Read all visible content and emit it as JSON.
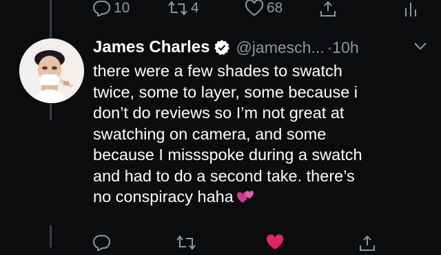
{
  "prev_actions": {
    "reply_count": "10",
    "retweet_count": "4",
    "like_count": "68"
  },
  "tweet": {
    "name": "James Charles",
    "handle": "@jamesch...",
    "time": "·10h",
    "lines": [
      "there were a few shades to swatch",
      "twice, some to layer, some because i",
      "don’t do reviews so I’m not great at",
      "swatching on camera, and some",
      "because I missspoke during a swatch",
      "and had to do a second take. there’s",
      "no conspiracy haha"
    ],
    "emoji": "two-hearts"
  },
  "icons": {
    "reply": "reply-icon",
    "retweet": "retweet-icon",
    "like": "heart-icon",
    "share": "share-icon",
    "analytics": "analytics-icon",
    "verified": "verified-badge-icon",
    "more": "chevron-down-icon"
  },
  "colors": {
    "background": "#0b0c0e",
    "secondary_text": "#8b98a5",
    "like_active": "#e0245e"
  }
}
